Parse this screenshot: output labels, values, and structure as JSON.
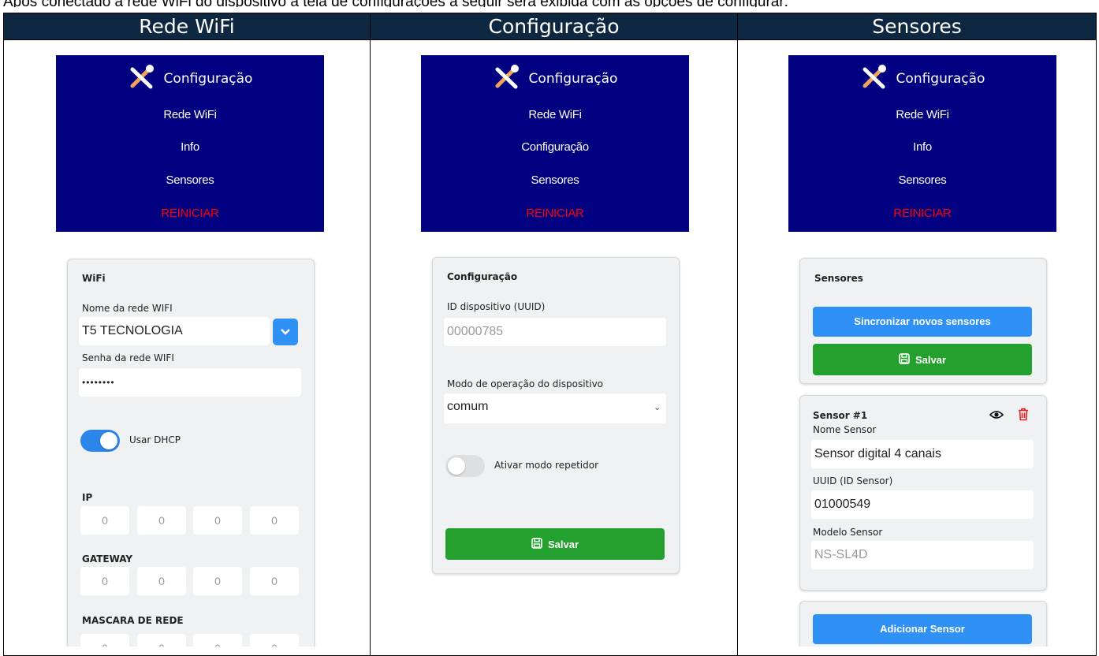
{
  "caption": "Após conectado a rede WiFi do dispositivo a tela de configurações a seguir será exibida com as opções de configurar:",
  "columns": [
    "Rede WiFi",
    "Configuração",
    "Sensores"
  ],
  "nav": {
    "brand": "Configuração",
    "items": [
      "Rede WiFi",
      "Info",
      "Sensores"
    ],
    "items_config": [
      "Rede WiFi",
      "Configuração",
      "Sensores"
    ],
    "reboot": "REINICIAR",
    "reboot_color": "#ff0000",
    "background": "#000080"
  },
  "wifi": {
    "title": "WiFi",
    "ssid_label": "Nome da rede WIFI",
    "ssid_value": "T5 TECNOLOGIA",
    "password_label": "Senha da rede WIFI",
    "password_value": "••••••••",
    "dhcp_label": "Usar DHCP",
    "dhcp_enabled": true,
    "ip_label": "IP",
    "gateway_label": "GATEWAY",
    "mask_label": "MASCARA DE REDE",
    "octet": "0"
  },
  "config": {
    "title": "Configuração",
    "uuid_label": "ID dispositivo (UUID)",
    "uuid_value": "00000785",
    "mode_label": "Modo de operação do dispositivo",
    "mode_value": "comum",
    "repeater_label": "Ativar modo repetidor",
    "repeater_enabled": false,
    "save_label": "Salvar"
  },
  "sensors": {
    "title": "Sensores",
    "sync_label": "Sincronizar novos sensores",
    "save_label": "Salvar",
    "sensor_title": "Sensor #1",
    "name_label": "Nome Sensor",
    "name_value": "Sensor digital 4 canais",
    "uuid_label": "UUID (ID Sensor)",
    "uuid_value": "01000549",
    "model_label": "Modelo Sensor",
    "model_value": "NS-SL4D",
    "add_label": "Adicionar Sensor"
  },
  "colors": {
    "header_bg": "#0e2841",
    "primary": "#2f91f5",
    "success": "#23a02d",
    "danger": "#e62020"
  }
}
